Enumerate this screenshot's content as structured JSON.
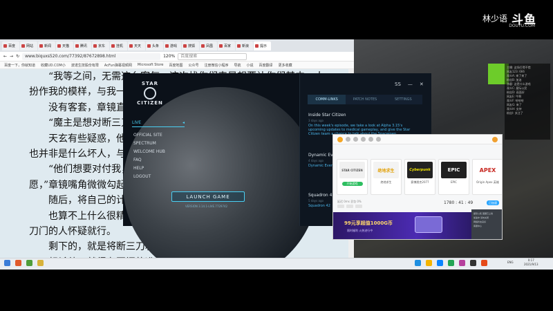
{
  "stream": {
    "streamer_name": "林少语",
    "platform_logo": "斗鱼",
    "platform_sub": "DOUYU.COM"
  },
  "browser": {
    "tabs": [
      "百度",
      "网站",
      "新闻",
      "天猫",
      "腾讯",
      "京东",
      "挂机",
      "天天",
      "头条",
      "游戏",
      "搜狐",
      "凤凰",
      "百家",
      "新浪",
      "提示"
    ],
    "url": "www.biquxs520.com/77392/87672898.html",
    "zoom": "120%",
    "search_placeholder": "百度搜索",
    "bookmarks": [
      "百度一下，你就知道",
      "收藏UD.COM小",
      "波诺生技股份有限",
      "AcFun弹幕视频网",
      "Microsoft Store",
      "百度地图",
      "公众号",
      "注册微信小程序",
      "导航",
      "小说",
      "百度翻译",
      "更多收藏"
    ]
  },
  "article": {
    "paragraphs": [
      "“我等之间，无需这么客气。这次找你们来是想要让你们其中一人扮作我的模样，与我一同出现在我派弟子的面前。",
      "没有客套，章镜直接开门见山的道。",
      "“魔主是想对断三刀出手？”",
      "天玄有些疑惑，他们之间的关系看着可是非常不错，况且他本身也并非是什么坏人，与他们之间关系看着可是非常不错的。",
      "“他们想要对付我，我自然也不可能坐以待毙，只能如他们所愿，”章镜嘴角微微勾起。",
      "随后，将自己的计划详细的说了出来。",
      "也算不上什么很精妙的谋划，断三刀心中必然有所察觉，对于血刀门的人怀疑就行。",
      "剩下的，就是将断三刀和宋天行引出来，给他们来个了断！",
      "想杀他，就得有灭门的准备！"
    ]
  },
  "launcher": {
    "logo_top": "STAR",
    "logo_bottom": "CITIZEN",
    "live_label": "LIVE",
    "menu": [
      "OFFICIAL SITE",
      "SPECTRUM",
      "WELCOME HUB",
      "FAQ",
      "HELP",
      "LOGOUT"
    ],
    "launch_label": "LAUNCH GAME",
    "version": "VERSION 3.14.1-LIVE.7729742",
    "window_controls": [
      "SS",
      "—",
      "✕"
    ],
    "news_tabs": [
      "COMM-LINKS",
      "PATCH NOTES",
      "SETTINGS"
    ],
    "news": [
      {
        "title": "Inside Star Citizen",
        "date": "3 days ago",
        "body": "On this week's episode, we take a look at Alpha 3.15's upcoming updates to medical gameplay, and give the Star Citizen team a chance to talk about the Spacemen"
      },
      {
        "title": "Dynamic Events",
        "date": "4 days ago",
        "body": "Dynamic Events submission form various space were"
      },
      {
        "title": "Squadron 42",
        "date": "5 days ago",
        "body": "Squadron 42"
      }
    ]
  },
  "store": {
    "games": [
      {
        "art": "STAR CITIZEN",
        "name": "",
        "action": "开始游戏"
      },
      {
        "art": "绝地求生",
        "name": "绝地求生",
        "action": ""
      },
      {
        "art": "Cyberpunk",
        "name": "赛博朋克2077",
        "action": ""
      },
      {
        "art": "EPIC",
        "name": "EPIC",
        "action": ""
      },
      {
        "art": "APEX",
        "name": "Origin Apex 英雄",
        "action": ""
      }
    ],
    "stats": "延迟 0ms   丢包 0%",
    "timer": "1780 : 41 : 49",
    "accel_label": "已加速",
    "promo_text": "99元享超值1000G币",
    "promo_sub": "限时福利 火热进行中",
    "side_lines": [
      "星际公民 国服已上线",
      "加速中 请勿关闭",
      "网络状态良好",
      "客服中心"
    ]
  },
  "chat_overlay": [
    "主播: 这场打得不错",
    "网友123: 666",
    "观众A: 来了来了",
    "粉丝B: 加油",
    "游客: 这是什么游戏",
    "观众C: 星际公民",
    "粉丝D: 画面好",
    "网友E: 牛啊",
    "观众F: 哈哈哈",
    "网友G: 来了",
    "观众H: 支持",
    "粉丝I: 关注了"
  ],
  "taskbar": {
    "tray_text": "ENG",
    "time": "0:17",
    "date": "2021/9/13"
  },
  "colors": {
    "accent_cyan": "#4ad0f4",
    "article_bg": "#dfeaf0",
    "store_green": "#2dbe60",
    "overlay_green": "#6dcc2a"
  }
}
